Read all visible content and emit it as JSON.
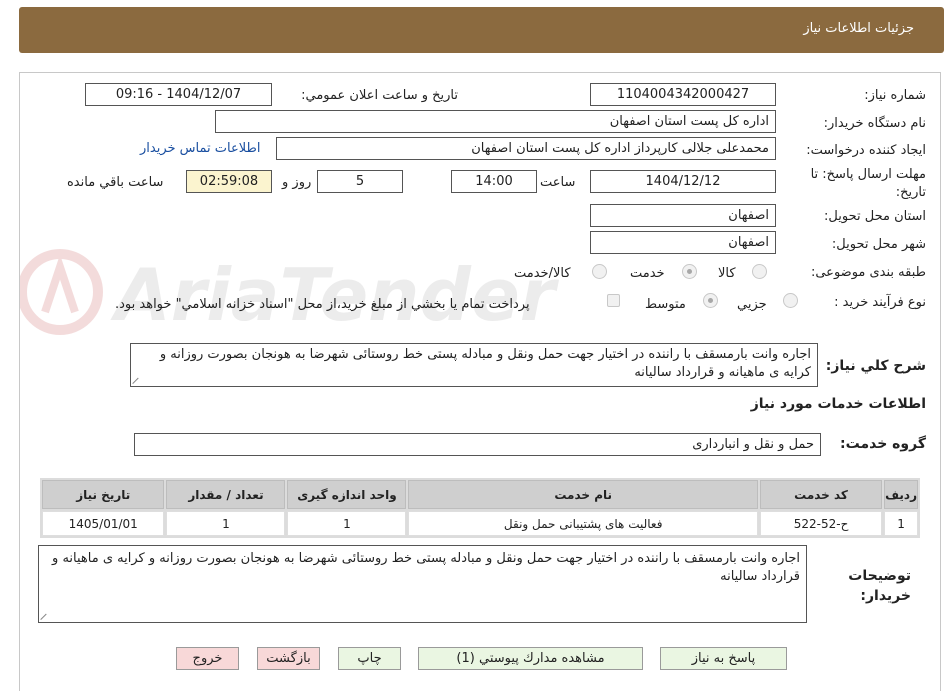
{
  "header": {
    "title": "جزئيات اطلاعات نياز"
  },
  "form": {
    "need_number_label": "شماره نياز:",
    "need_number": "1104004342000427",
    "announce_label": "تاريخ و ساعت اعلان عمومي:",
    "announce_value": "1404/12/07 - 09:16",
    "buyer_org_label": "نام دستگاه خريدار:",
    "buyer_org": "اداره كل پست استان اصفهان",
    "requester_label": "ايجاد كننده درخواست:",
    "requester": "محمدعلی جلالی کارپرداز اداره کل پست استان اصفهان",
    "contact_link": "اطلاعات تماس خريدار",
    "deadline_label": "مهلت ارسال پاسخ: تا تاريخ:",
    "deadline_date": "1404/12/12",
    "time_label": "ساعت",
    "deadline_time": "14:00",
    "days_value": "5",
    "days_label": "روز و",
    "remaining_time": "02:59:08",
    "remaining_label": "ساعت باقي مانده",
    "province_label": "استان محل تحويل:",
    "province": "اصفهان",
    "city_label": "شهر محل تحويل:",
    "city": "اصفهان",
    "category_label": "طبقه بندی موضوعی:",
    "category_options": [
      "كالا",
      "خدمت",
      "كالا/خدمت"
    ],
    "category_selected": "خدمت",
    "process_label": "نوع فرآيند خريد :",
    "process_options": [
      "جزيي",
      "متوسط"
    ],
    "process_selected": "متوسط",
    "payment_note": "پرداخت تمام يا بخشي از مبلغ خريد،از محل \"اسناد خزانه اسلامي\" خواهد بود.",
    "summary_label": "شرح كلي نياز:",
    "summary": "اجاره وانت بارمسقف با راننده در اختیار جهت حمل ونقل و مبادله پستی خط روستائی شهرضا به هونجان بصورت روزانه و کرایه ی ماهیانه و قرارداد سالیانه"
  },
  "services": {
    "section_title": "اطلاعات خدمات مورد نياز",
    "group_label": "گروه خدمت:",
    "group_value": "حمل و نقل و انبارداری",
    "columns": [
      "رديف",
      "كد خدمت",
      "نام خدمت",
      "واحد اندازه گيری",
      "تعداد / مقدار",
      "تاريخ نياز"
    ],
    "rows": [
      [
        "1",
        "ح-52-522",
        "فعالیت های پشتیبانی حمل ونقل",
        "1",
        "1",
        "1405/01/01"
      ]
    ]
  },
  "buyer_notes": {
    "label": "توضيحات خريدار:",
    "text": "اجاره وانت بارمسقف با راننده در اختیار جهت حمل ونقل و مبادله پستی خط روستائی شهرضا به هونجان بصورت روزانه و کرایه ی ماهیانه و قرارداد سالیانه"
  },
  "buttons": {
    "reply": "پاسخ به نياز",
    "attachments": "مشاهده مدارك پيوستي (1)",
    "print": "چاپ",
    "back": "بازگشت",
    "exit": "خروج"
  },
  "colors": {
    "header_bg": "#8b6a3f",
    "green_btn": "#eaf6e2",
    "red_btn": "#f8d8d8",
    "yellow_box": "#fbf4cf"
  }
}
